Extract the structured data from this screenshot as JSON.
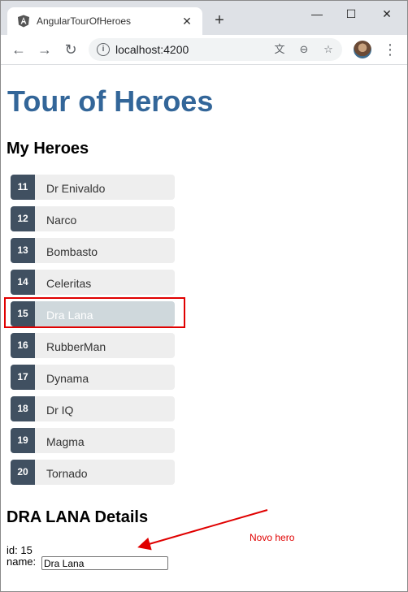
{
  "browser": {
    "tab_title": "AngularTourOfHeroes",
    "tab_close": "✕",
    "new_tab": "+",
    "window_controls": {
      "minimize": "—",
      "maximize": "☐",
      "close": "✕"
    },
    "url": "localhost:4200"
  },
  "app": {
    "title": "Tour of Heroes",
    "heroes_heading": "My Heroes",
    "heroes": [
      {
        "id": "11",
        "name": "Dr Enivaldo"
      },
      {
        "id": "12",
        "name": "Narco"
      },
      {
        "id": "13",
        "name": "Bombasto"
      },
      {
        "id": "14",
        "name": "Celeritas"
      },
      {
        "id": "15",
        "name": "Dra Lana"
      },
      {
        "id": "16",
        "name": "RubberMan"
      },
      {
        "id": "17",
        "name": "Dynama"
      },
      {
        "id": "18",
        "name": "Dr IQ"
      },
      {
        "id": "19",
        "name": "Magma"
      },
      {
        "id": "20",
        "name": "Tornado"
      }
    ],
    "selected_index": 4,
    "details": {
      "heading": "DRA LANA Details",
      "id_text": "id: 15",
      "name_label": "name:",
      "name_value": "Dra Lana"
    }
  },
  "annotation": {
    "text": "Novo hero",
    "color": "#e00000"
  },
  "colors": {
    "title": "#336699",
    "badge": "#405061",
    "item_bg": "#eeeeee",
    "selected_bg": "#cfd8dc"
  }
}
